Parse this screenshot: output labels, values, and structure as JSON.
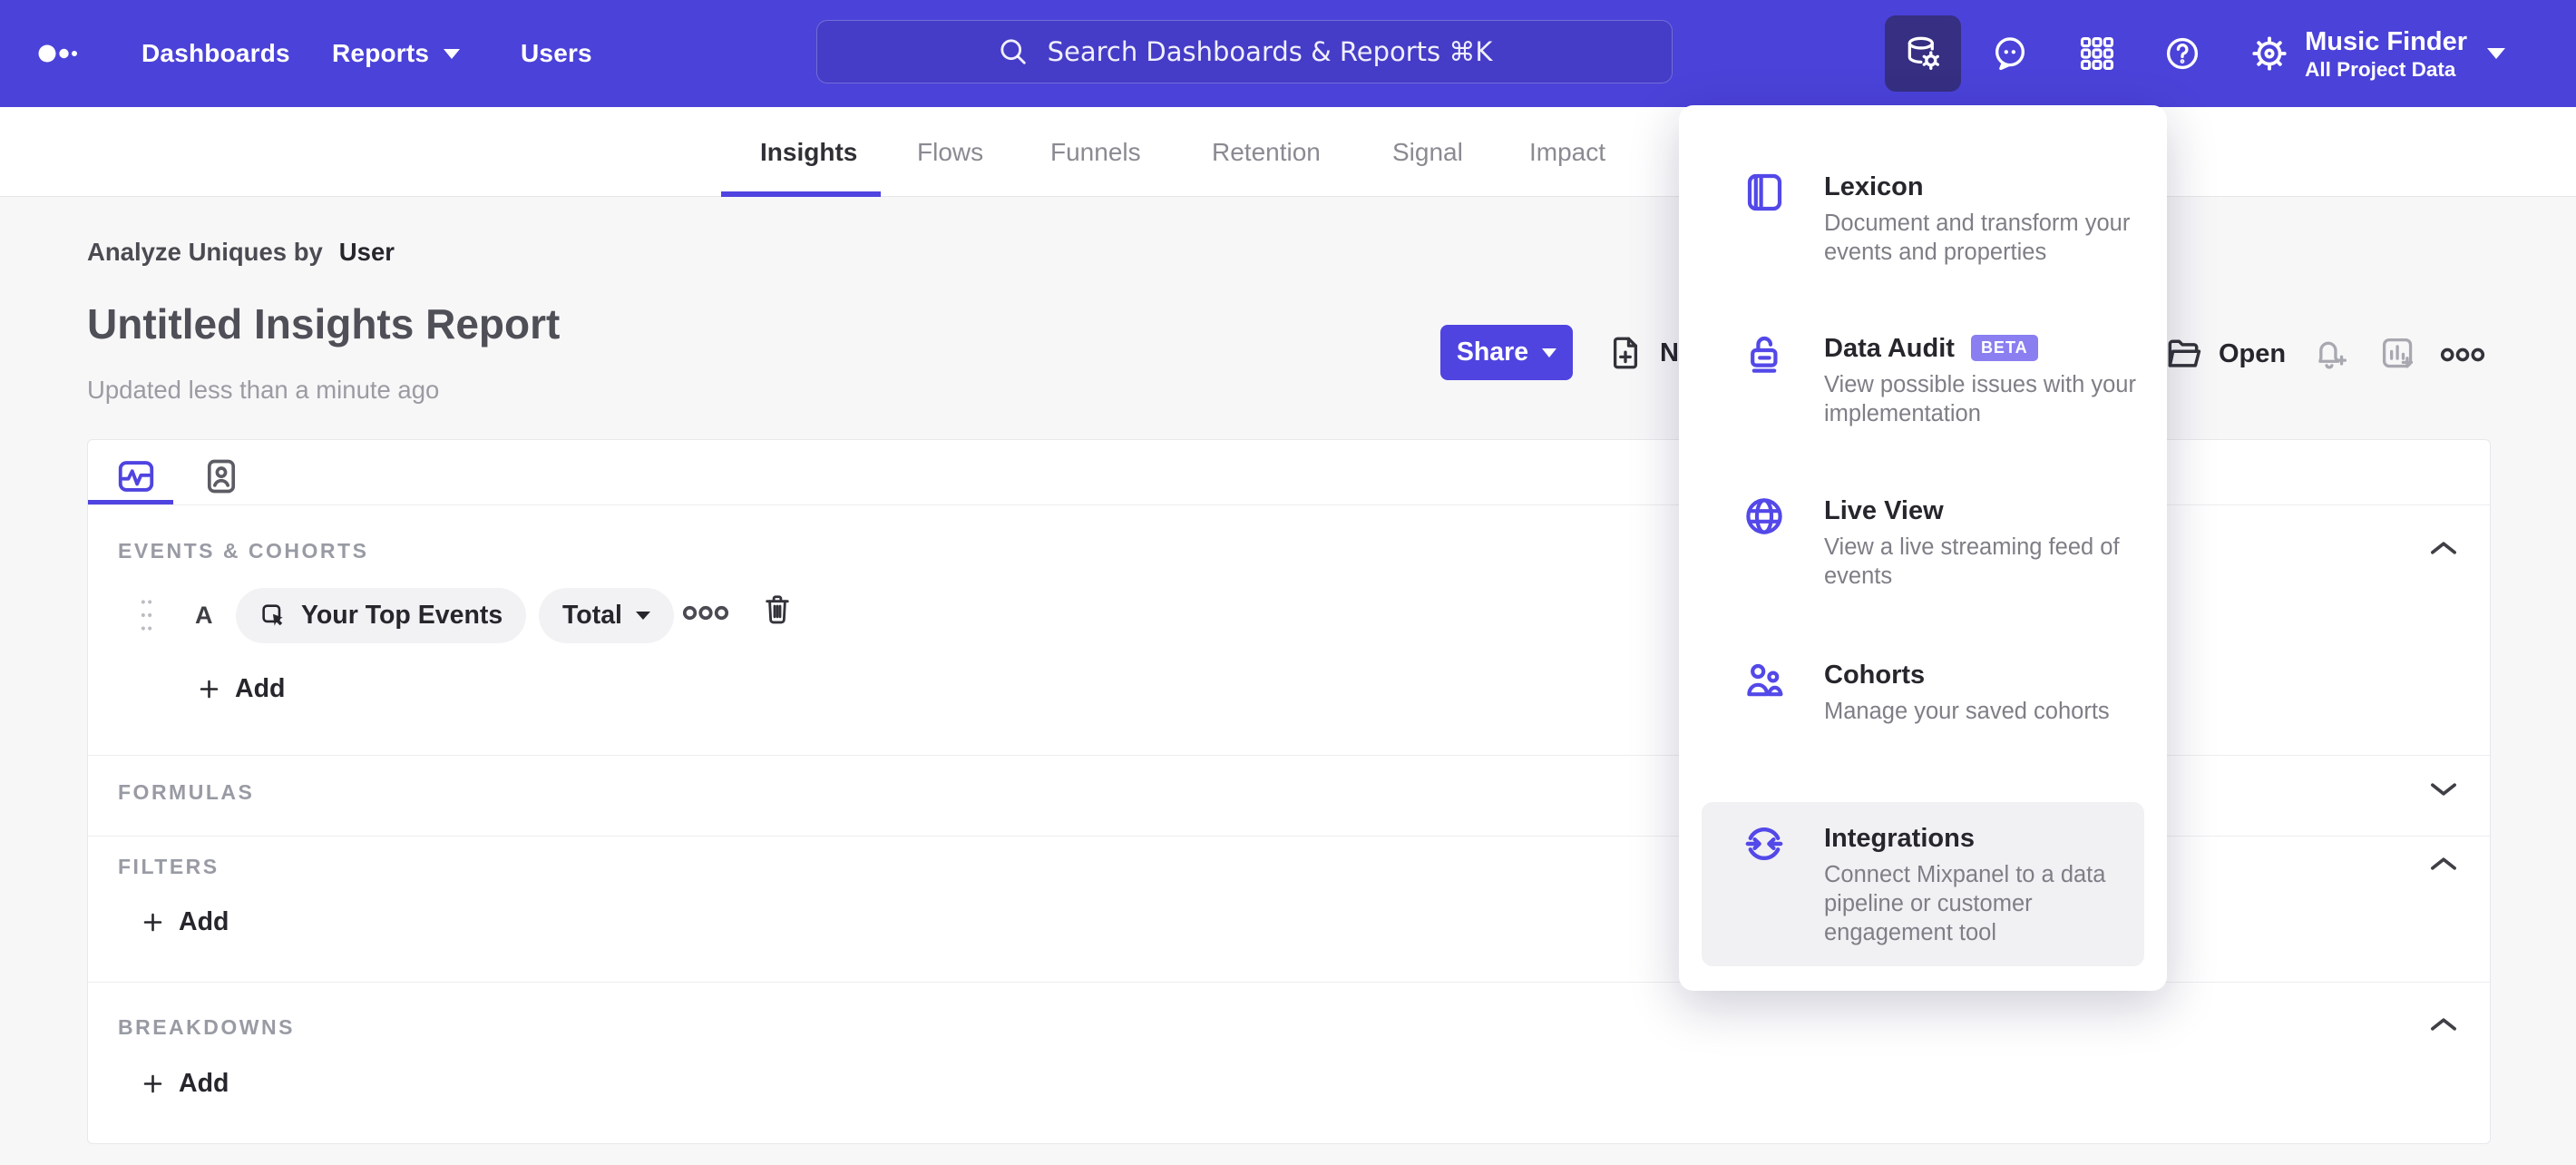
{
  "nav": {
    "links": [
      "Dashboards",
      "Reports",
      "Users"
    ],
    "search": {
      "placeholder": "Search Dashboards & Reports ⌘K"
    },
    "icon_names": [
      "data-management",
      "feedback",
      "apps-grid",
      "help",
      "settings"
    ],
    "project": {
      "name": "Music Finder",
      "scope": "All Project Data"
    }
  },
  "tabs": {
    "items": [
      "Insights",
      "Flows",
      "Funnels",
      "Retention",
      "Signal",
      "Impact"
    ],
    "active": "Insights"
  },
  "report": {
    "analyze_label": "Analyze Uniques by",
    "analyze_value": "User",
    "title": "Untitled Insights Report",
    "updated": "Updated less than a minute ago"
  },
  "toolbar": {
    "share_label": "Share",
    "new_label": "New",
    "open_label": "Open"
  },
  "apps_menu": {
    "items": [
      {
        "name": "Lexicon",
        "desc": "Document and transform your events and properties",
        "icon": "lexicon-book"
      },
      {
        "name": "Data Audit",
        "badge": "BETA",
        "desc": "View possible issues with your implementation",
        "icon": "data-audit-lock"
      },
      {
        "name": "Live View",
        "desc": "View a live streaming feed of events",
        "icon": "live-view-globe"
      },
      {
        "name": "Cohorts",
        "desc": "Manage your saved cohorts",
        "icon": "cohorts-people"
      },
      {
        "name": "Integrations",
        "desc": "Connect Mixpanel to a data pipeline or customer engagement tool",
        "icon": "integrations-sync",
        "highlighted": true
      }
    ]
  },
  "builder": {
    "sections": [
      {
        "label": "EVENTS & COHORTS",
        "chevron": "up"
      },
      {
        "label": "FORMULAS",
        "chevron": "down"
      },
      {
        "label": "FILTERS",
        "chevron": "up"
      },
      {
        "label": "BREAKDOWNS",
        "chevron": "up"
      }
    ],
    "event_row": {
      "letter": "A",
      "event_label": "Your Top Events",
      "aggregation_label": "Total"
    },
    "add_label": "Add"
  },
  "colors": {
    "accent": "#4f44e0",
    "nav_background": "#4b42d9",
    "search_background": "#453cc7",
    "active_nav_icon_background": "#362f82",
    "beta_badge": "#8a7ef1",
    "highlight_row": "#f1f1f4",
    "page_background": "#f7f7f8"
  }
}
